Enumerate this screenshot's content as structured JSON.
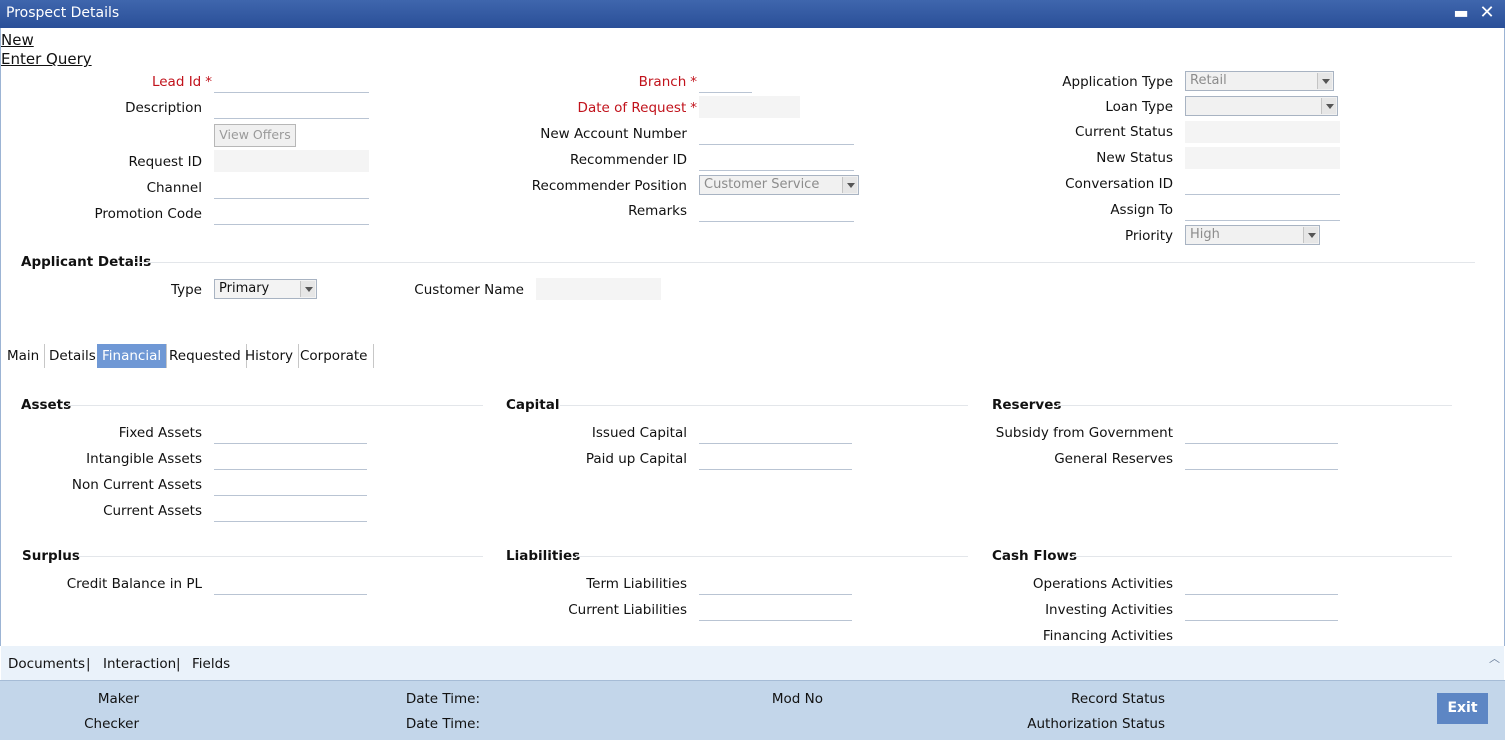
{
  "window": {
    "title": "Prospect Details",
    "minimize_glyph": "▬",
    "close_glyph": "✕"
  },
  "actions": {
    "new": "New",
    "enter_query": "Enter Query"
  },
  "header": {
    "lead_id": "Lead Id",
    "description": "Description",
    "view_offers": "View Offers",
    "request_id": "Request ID",
    "channel": "Channel",
    "promotion_code": "Promotion Code",
    "branch": "Branch",
    "date_of_request": "Date of Request",
    "new_account_number": "New Account Number",
    "recommender_id": "Recommender ID",
    "recommender_position": "Recommender Position",
    "recommender_position_value": "Customer Service",
    "remarks": "Remarks",
    "application_type": "Application Type",
    "application_type_value": "Retail",
    "loan_type": "Loan Type",
    "loan_type_value": "",
    "current_status": "Current Status",
    "new_status": "New Status",
    "conversation_id": "Conversation ID",
    "assign_to": "Assign To",
    "priority": "Priority",
    "priority_value": "High",
    "required_mark": "*"
  },
  "applicant": {
    "section": "Applicant Details",
    "type": "Type",
    "type_value": "Primary",
    "customer_name": "Customer Name"
  },
  "tabs": [
    {
      "label": "Main"
    },
    {
      "label": "Details"
    },
    {
      "label": "Financial"
    },
    {
      "label": "Requested"
    },
    {
      "label": "History"
    },
    {
      "label": "Corporate"
    }
  ],
  "financial": {
    "assets": {
      "title": "Assets",
      "fixed_assets": "Fixed Assets",
      "intangible_assets": "Intangible Assets",
      "non_current_assets": "Non Current Assets",
      "current_assets": "Current Assets"
    },
    "capital": {
      "title": "Capital",
      "issued_capital": "Issued Capital",
      "paid_up_capital": "Paid up Capital"
    },
    "reserves": {
      "title": "Reserves",
      "subsidy": "Subsidy from Government",
      "general_reserves": "General Reserves"
    },
    "surplus": {
      "title": "Surplus",
      "credit_balance": "Credit Balance in PL"
    },
    "liabilities": {
      "title": "Liabilities",
      "term_liabilities": "Term Liabilities",
      "current_liabilities": "Current Liabilities"
    },
    "cash_flows": {
      "title": "Cash Flows",
      "operations": "Operations Activities",
      "investing": "Investing Activities",
      "financing": "Financing Activities"
    }
  },
  "bottom_links": {
    "documents": "Documents",
    "interaction": "Interaction",
    "fields": "Fields",
    "separator": "|"
  },
  "footer": {
    "maker": "Maker",
    "checker": "Checker",
    "date_time_1": "Date Time:",
    "date_time_2": "Date Time:",
    "mod_no": "Mod No",
    "record_status": "Record Status",
    "authorization_status": "Authorization Status",
    "exit": "Exit"
  },
  "colors": {
    "titlebar": "#2a4f98",
    "required": "#c1121b",
    "tab_active": "#6f98d5",
    "footer": "#c3d6ea",
    "exit_button": "#5d86c4"
  }
}
